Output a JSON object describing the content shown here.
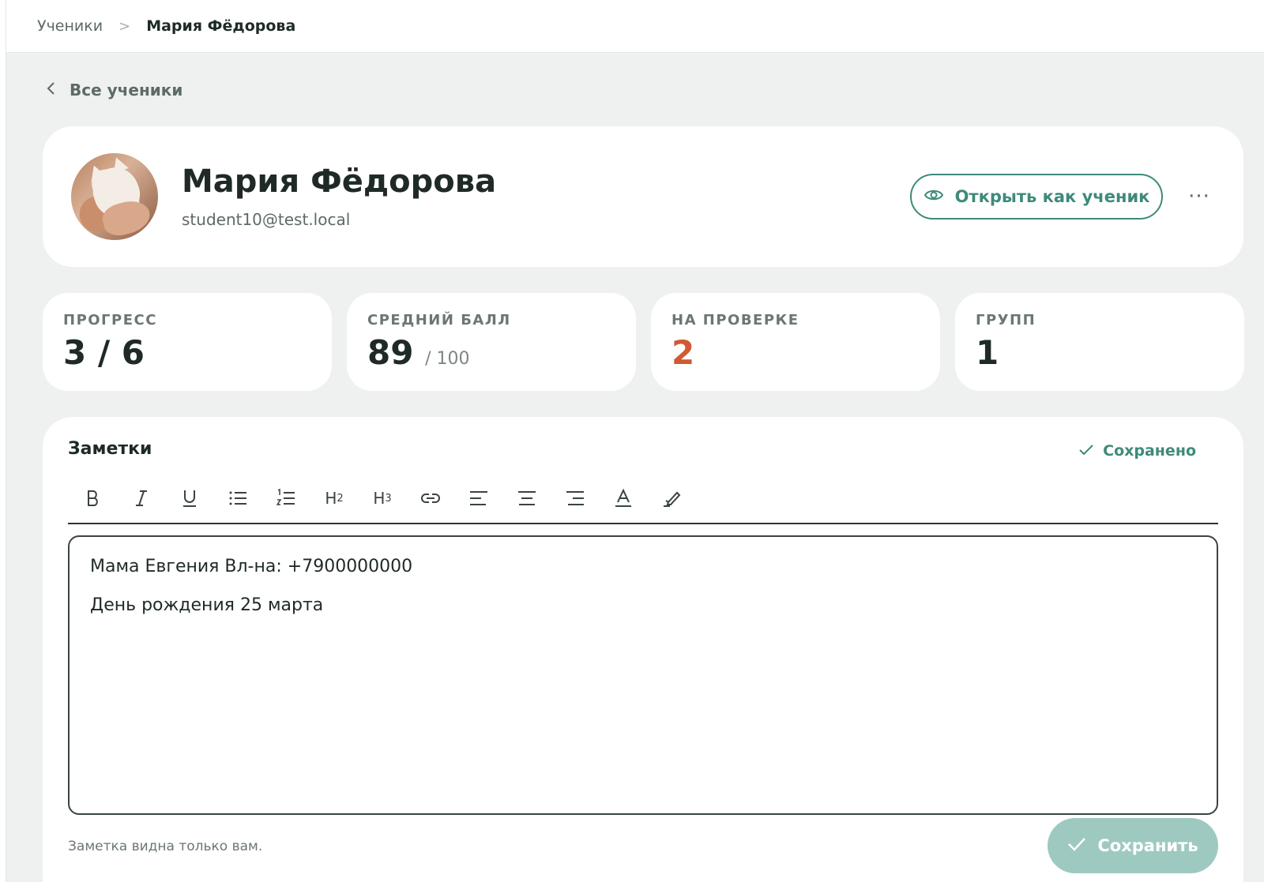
{
  "breadcrumb": {
    "parent": "Ученики",
    "separator": ">",
    "current": "Мария Фёдорова"
  },
  "back_link": "Все ученики",
  "profile": {
    "name": "Мария Фёдорова",
    "email": "student10@test.local",
    "open_as_student": "Открыть как ученик",
    "more": "···"
  },
  "stats": [
    {
      "label": "ПРОГРЕСС",
      "value": "3 / 6",
      "suffix": ""
    },
    {
      "label": "СРЕДНИЙ БАЛЛ",
      "value": "89",
      "suffix": "/ 100"
    },
    {
      "label": "НА ПРОВЕРКЕ",
      "value": "2",
      "suffix": ""
    },
    {
      "label": "ГРУПП",
      "value": "1",
      "suffix": ""
    }
  ],
  "notes": {
    "title": "Заметки",
    "saved_status": "Сохранено",
    "toolbar": {
      "h2": "H",
      "h2_sub": "2",
      "h3": "H",
      "h3_sub": "3"
    },
    "lines": [
      "Мама Евгения Вл-на: +7900000000",
      "День рождения 25 марта"
    ],
    "hint": "Заметка видна только вам.",
    "save_label": "Сохранить"
  },
  "colors": {
    "accent": "#3e8a7a",
    "pending": "#cf5a34",
    "save_button_bg": "#9ec9c1",
    "page_bg": "#eef1f0"
  }
}
